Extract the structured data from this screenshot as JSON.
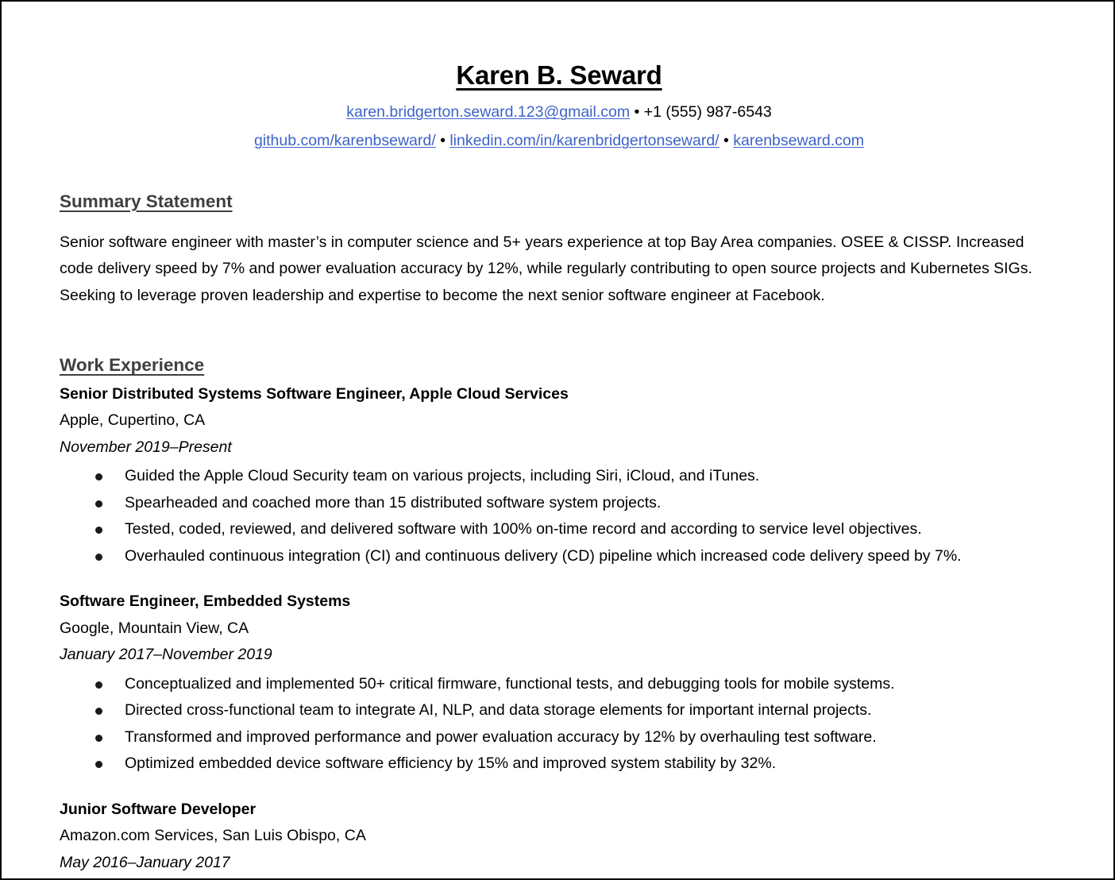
{
  "header": {
    "name": "Karen B. Seward",
    "contact_line_1": {
      "email": "karen.bridgerton.seward.123@gmail.com",
      "separator": "•",
      "phone": "+1 (555) 987-6543"
    },
    "contact_line_2": {
      "github": "github.com/karenbseward/",
      "separator_1": "•",
      "linkedin": "linkedin.com/in/karenbridgertonseward/",
      "separator_2": "•",
      "website": "karenbseward.com"
    }
  },
  "sections": {
    "summary": {
      "heading": "Summary Statement",
      "text": "Senior software engineer with master’s in computer science and 5+ years experience at top Bay Area companies. OSEE & CISSP. Increased code delivery speed by 7% and power evaluation accuracy by 12%, while regularly contributing to open source projects and Kubernetes SIGs. Seeking to leverage proven leadership and expertise to become the next senior software engineer at Facebook."
    },
    "work_experience": {
      "heading": "Work Experience",
      "jobs": [
        {
          "title": "Senior Distributed Systems Software Engineer, Apple Cloud Services",
          "company": "Apple, Cupertino, CA",
          "dates": "November 2019–Present",
          "bullets": [
            "Guided the Apple Cloud Security team on various projects, including Siri, iCloud, and iTunes.",
            "Spearheaded and coached more than 15 distributed software system projects.",
            "Tested, coded, reviewed, and delivered software with 100% on-time record and according to service level objectives.",
            "Overhauled continuous integration (CI) and continuous delivery (CD) pipeline which increased code delivery speed by 7%."
          ]
        },
        {
          "title": "Software Engineer, Embedded Systems",
          "company": "Google, Mountain View, CA",
          "dates": "January 2017–November 2019",
          "bullets": [
            "Conceptualized and implemented 50+ critical firmware, functional tests, and debugging tools for mobile systems.",
            "Directed cross-functional team to integrate AI, NLP, and data storage elements for important internal projects.",
            "Transformed and improved performance and power evaluation accuracy by 12% by overhauling test software.",
            "Optimized embedded device software efficiency by 15% and improved system stability by 32%."
          ]
        },
        {
          "title": "Junior Software Developer",
          "company": "Amazon.com Services, San Luis Obispo, CA",
          "dates": "May 2016–January 2017",
          "bullets": []
        }
      ]
    }
  },
  "colors": {
    "link": "#3d63c8",
    "heading": "#3f3f3f",
    "text": "#000000",
    "page_background": "#ffffff",
    "page_border": "#000000"
  }
}
